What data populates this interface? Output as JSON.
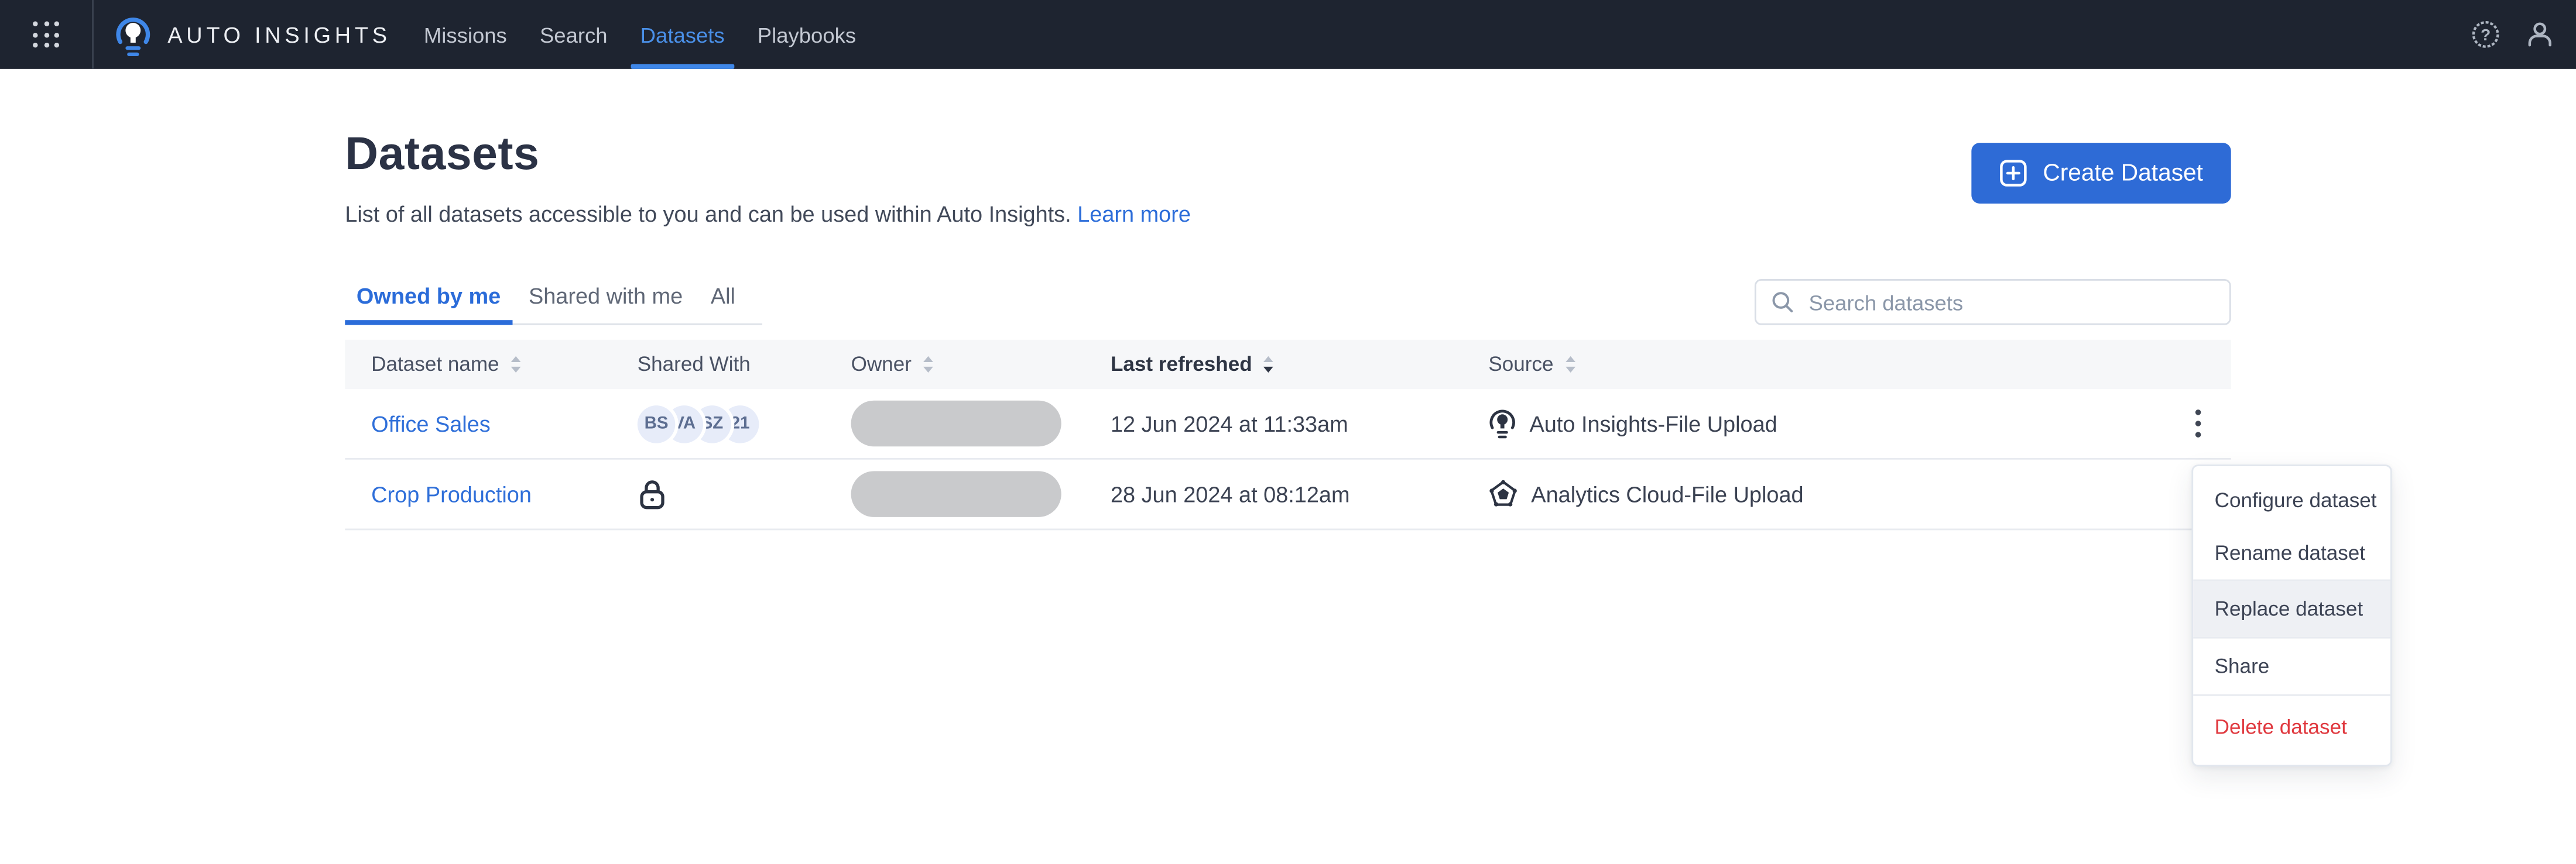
{
  "navbar": {
    "brand": "AUTO INSIGHTS",
    "items": [
      {
        "label": "Missions"
      },
      {
        "label": "Search"
      },
      {
        "label": "Datasets"
      },
      {
        "label": "Playbooks"
      }
    ]
  },
  "page": {
    "title": "Datasets",
    "subtitle": "List of all datasets accessible to you and can be used within Auto Insights. ",
    "learn_more_label": "Learn more",
    "create_button_label": "Create Dataset"
  },
  "tabs": [
    {
      "label": "Owned by me"
    },
    {
      "label": "Shared with me"
    },
    {
      "label": "All"
    }
  ],
  "search": {
    "placeholder": "Search datasets"
  },
  "table": {
    "columns": {
      "dataset_name": "Dataset name",
      "shared_with": "Shared With",
      "owner": "Owner",
      "last_refreshed": "Last refreshed",
      "source": "Source"
    },
    "rows": [
      {
        "name": "Office Sales",
        "shared_with_avatars": [
          "BS",
          "VA",
          "SZ",
          "21"
        ],
        "last_refreshed": "12 Jun 2024 at 11:33am",
        "source": "Auto Insights-File Upload"
      },
      {
        "name": "Crop Production",
        "last_refreshed": "28 Jun 2024 at 08:12am",
        "source": "Analytics Cloud-File Upload"
      }
    ]
  },
  "context_menu": {
    "configure": "Configure dataset",
    "rename": "Rename dataset",
    "replace": "Replace dataset",
    "share": "Share",
    "delete": "Delete dataset"
  },
  "colors": {
    "navbar_bg": "#1e2430",
    "accent_blue": "#2e6bd6",
    "link_blue": "#2b6cd9",
    "nav_active_blue": "#4a90e8",
    "danger_red": "#e0393f",
    "header_bg": "#f6f7f9",
    "avatar_bg": "#e7ecf9",
    "owner_pill_grey": "#c9cacc"
  }
}
